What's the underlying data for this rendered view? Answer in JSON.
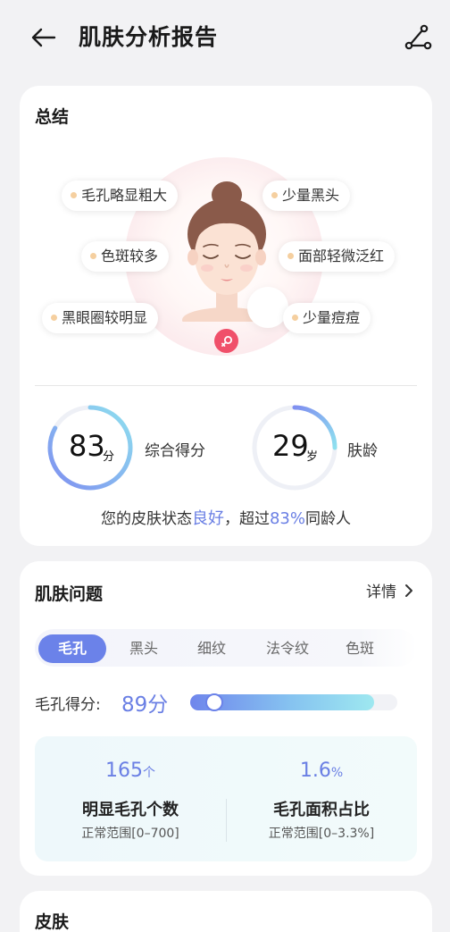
{
  "header": {
    "title": "肌肤分析报告",
    "back_icon": "arrow-left-icon",
    "share_icon": "share-nodes-icon"
  },
  "summary": {
    "title": "总结",
    "tags": [
      "毛孔略显粗大",
      "少量黑头",
      "色斑较多",
      "面部轻微泛红",
      "黑眼圈较明显",
      "少量痘痘"
    ],
    "overall": {
      "value": "83",
      "unit": "分",
      "label": "综合得分",
      "percent": 83
    },
    "age": {
      "value": "29",
      "unit": "岁",
      "label": "肤龄"
    },
    "status_prefix": "您的皮肤状态",
    "status_value": "良好",
    "status_middle": "，超过",
    "status_percent": "83%",
    "status_suffix": "同龄人"
  },
  "issues": {
    "title": "肌肤问题",
    "detail_label": "详情",
    "tabs": [
      "毛孔",
      "黑头",
      "细纹",
      "法令纹",
      "色斑"
    ],
    "active_tab": 0,
    "score_label": "毛孔得分:",
    "score_value": "89分",
    "score_percent": 89,
    "stats": [
      {
        "value": "165",
        "unit": "个",
        "name": "明显毛孔个数",
        "range": "正常范围[0–700]"
      },
      {
        "value": "1.6",
        "unit": "%",
        "name": "毛孔面积占比",
        "range": "正常范围[0–3.3%]"
      }
    ]
  },
  "skin": {
    "title": "皮肤"
  },
  "colors": {
    "accent": "#6b82e9",
    "tag_dot": "#f5cf9f",
    "badge": "#f0506a"
  }
}
